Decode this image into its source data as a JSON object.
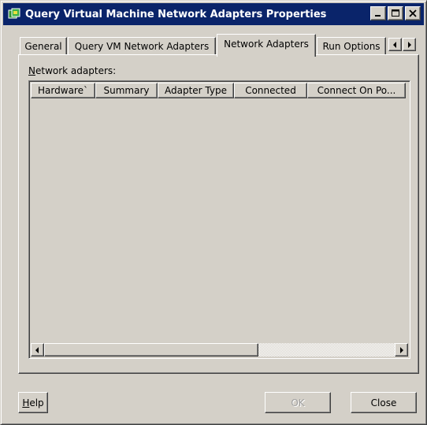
{
  "window": {
    "title": "Query Virtual Machine Network Adapters Properties",
    "colors": {
      "titlebar": "#0a246a",
      "face": "#d4d0c8",
      "title_text": "#ffffff"
    },
    "icon": "app-icon",
    "controls": {
      "minimize": "minimize-icon",
      "maximize": "maximize-icon",
      "close": "close-icon"
    }
  },
  "tabs": [
    {
      "label": "General",
      "active": false
    },
    {
      "label": "Query VM Network Adapters",
      "active": false
    },
    {
      "label": "Network Adapters",
      "active": true
    },
    {
      "label": "Run Options",
      "active": false
    }
  ],
  "tab_scroll": {
    "left": "arrow-left-icon",
    "right": "arrow-right-icon"
  },
  "panel": {
    "group_label_accel": "N",
    "group_label_rest": "etwork adapters:",
    "columns": [
      "Hardware`",
      "Summary",
      "Adapter Type",
      "Connected",
      "Connect On Po..."
    ],
    "rows": [],
    "scrollbar": {
      "left_icon": "arrow-left-icon",
      "right_icon": "arrow-right-icon"
    }
  },
  "buttons": {
    "help_accel": "H",
    "help_rest": "elp",
    "ok": "OK",
    "ok_enabled": false,
    "close": "Close"
  }
}
